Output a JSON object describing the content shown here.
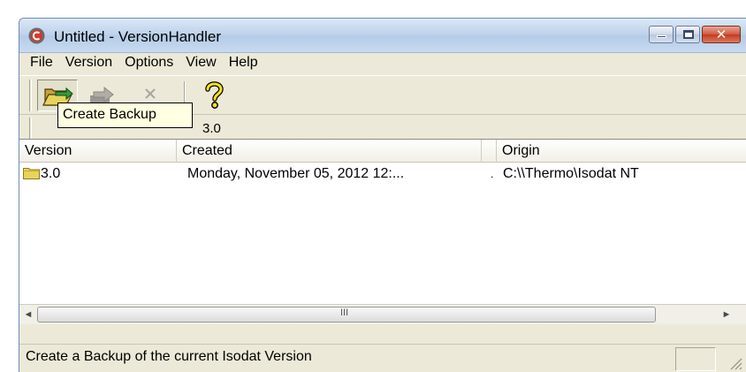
{
  "window": {
    "title": "Untitled - VersionHandler",
    "app_icon": "versionhandler-app-icon",
    "controls": [
      "minimize-icon",
      "maximize-icon",
      "close-icon"
    ],
    "close_glyph": "✕"
  },
  "menu": {
    "items": [
      "File",
      "Version",
      "Options",
      "View",
      "Help"
    ]
  },
  "toolbar": {
    "buttons": [
      {
        "name": "create-backup",
        "icon": "open-folder-arrow-icon",
        "pressed": true,
        "enabled": true
      },
      {
        "name": "restore",
        "icon": "restore-arrow-icon",
        "enabled": false
      },
      {
        "name": "delete",
        "icon": "delete-x-icon",
        "enabled": false
      },
      {
        "name": "help",
        "icon": "question-mark-icon",
        "enabled": true
      }
    ],
    "tooltip": "Create Backup",
    "version_combo_value": "3.0"
  },
  "list": {
    "columns": [
      "Version",
      "Created",
      "Origin"
    ],
    "rows": [
      {
        "version": "3.0",
        "created": "Monday, November 05, 2012 12:...",
        "origin": "C:\\\\Thermo\\Isodat NT",
        "icon": "folder-icon"
      }
    ]
  },
  "scrollbar": {
    "left_arrow": "◄",
    "right_arrow": "►",
    "grip": "III"
  },
  "status": {
    "text": "Create a Backup of the current Isodat Version"
  },
  "colors": {
    "tooltip_bg": "#ffffe1",
    "window_bg": "#ece9d8",
    "titlebar": "#c8daf0",
    "close_button": "#c43b21",
    "folder": "#e8d45a"
  }
}
